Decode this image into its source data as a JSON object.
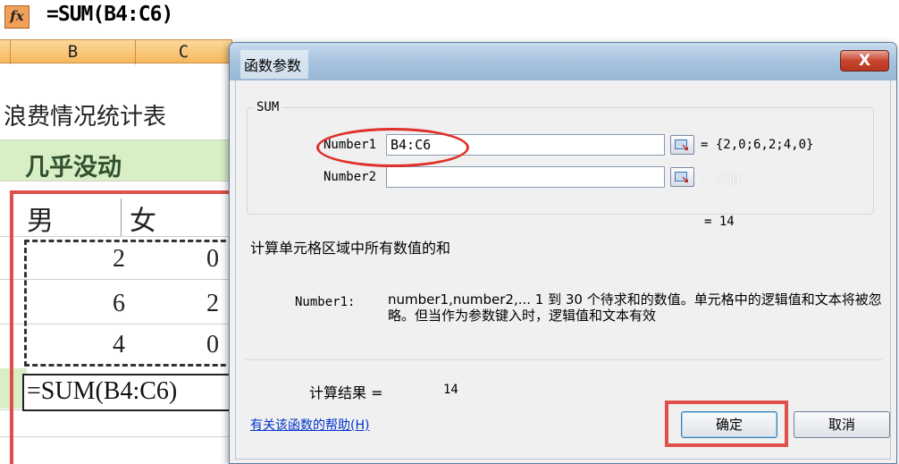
{
  "formula_bar": {
    "fx_label": "fx",
    "formula": "=SUM(B4:C6)"
  },
  "columns": [
    "B",
    "C"
  ],
  "sheet": {
    "title": "浪费情况统计表",
    "group_label": "几乎没动",
    "headers": [
      "男",
      "女"
    ],
    "rows": [
      [
        "2",
        "0"
      ],
      [
        "6",
        "2"
      ],
      [
        "4",
        "0"
      ]
    ],
    "active_cell_formula": "=SUM(B4:C6)"
  },
  "dialog": {
    "title": "函数参数",
    "close_label": "X",
    "function_name": "SUM",
    "args": [
      {
        "label": "Number1",
        "value": "B4:C6",
        "result": "= {2,0;6,2;4,0}"
      },
      {
        "label": "Number2",
        "value": "",
        "result": "= 数值"
      }
    ],
    "total_result": "= 14",
    "description": "计算单元格区域中所有数值的和",
    "arg_help_name": "Number1:",
    "arg_help_text": "number1,number2,... 1 到 30 个待求和的数值。单元格中的逻辑值和文本将被忽略。但当作为参数键入时，逻辑值和文本有效",
    "calc_result_label": "计算结果 =",
    "calc_result_value": "14",
    "help_link": "有关该函数的帮助(H)",
    "ok_label": "确定",
    "cancel_label": "取消"
  },
  "colors": {
    "annotation_red": "#e0504a",
    "header_orange": "#f6b95e",
    "green_fill": "#d8efc5"
  }
}
